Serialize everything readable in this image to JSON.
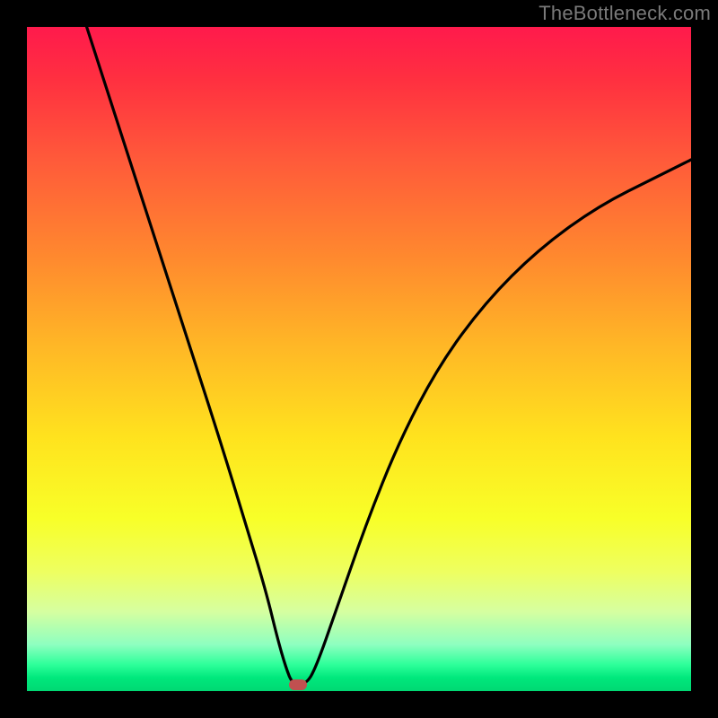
{
  "watermark": "TheBottleneck.com",
  "marker": {
    "x_frac": 0.408,
    "y_frac": 0.991
  },
  "chart_data": {
    "type": "line",
    "title": "",
    "xlabel": "",
    "ylabel": "",
    "xlim": [
      0,
      1
    ],
    "ylim": [
      0,
      1
    ],
    "series": [
      {
        "name": "bottleneck-curve",
        "x": [
          0.09,
          0.14,
          0.19,
          0.24,
          0.29,
          0.33,
          0.36,
          0.377,
          0.39,
          0.4,
          0.42,
          0.435,
          0.465,
          0.51,
          0.56,
          0.62,
          0.69,
          0.77,
          0.86,
          0.95,
          1.0
        ],
        "y": [
          1.0,
          0.845,
          0.69,
          0.535,
          0.38,
          0.25,
          0.15,
          0.08,
          0.035,
          0.01,
          0.01,
          0.035,
          0.12,
          0.25,
          0.375,
          0.49,
          0.585,
          0.665,
          0.73,
          0.775,
          0.8
        ]
      }
    ],
    "annotations": [
      {
        "type": "marker",
        "x": 0.408,
        "y": 0.009,
        "label": "optimal-point"
      }
    ],
    "background_gradient": {
      "top": "#ff1a4c",
      "mid": "#ffe31e",
      "bottom": "#00d873"
    }
  }
}
